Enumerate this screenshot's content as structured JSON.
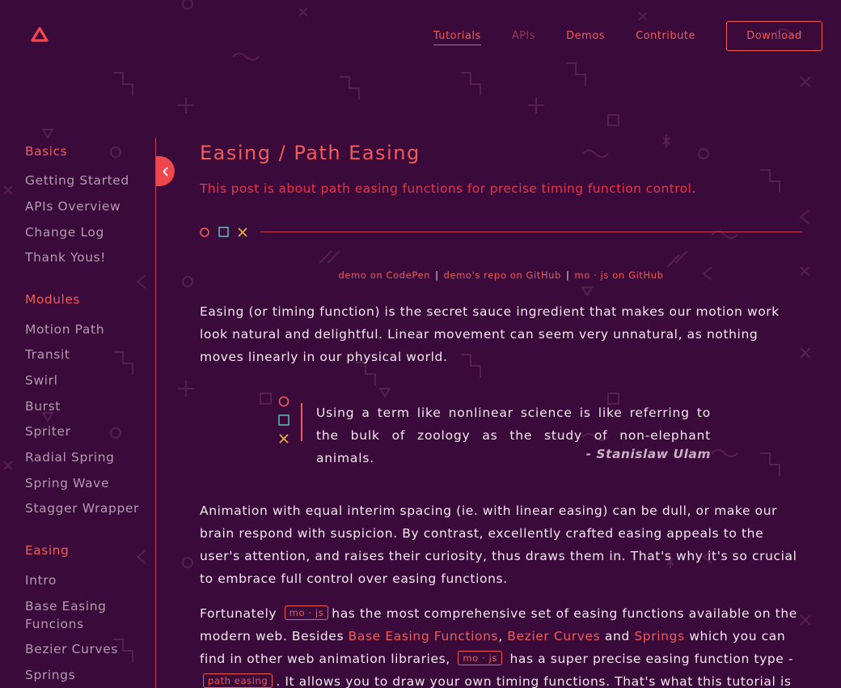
{
  "header": {
    "nav": [
      {
        "label": "Tutorials"
      },
      {
        "label": "APIs"
      },
      {
        "label": "Demos"
      },
      {
        "label": "Contribute"
      }
    ],
    "download_label": "Download"
  },
  "sidebar": {
    "groups": [
      {
        "title": "Basics",
        "items": [
          "Getting Started",
          "APIs Overview",
          "Change Log",
          "Thank Yous!"
        ]
      },
      {
        "title": "Modules",
        "items": [
          "Motion Path",
          "Transit",
          "Swirl",
          "Burst",
          "Spriter",
          "Radial Spring",
          "Spring Wave",
          "Stagger Wrapper"
        ]
      },
      {
        "title": "Easing",
        "items": [
          "Intro",
          "Base Easing Funcions",
          "Bezier Curves",
          "Springs"
        ]
      }
    ]
  },
  "main": {
    "title": "Easing / Path Easing",
    "subtitle": "This post is about path easing functions for precise timing function control.",
    "links": [
      "demo on CodePen",
      "demo's repo on GitHub",
      "mo · js on GitHub"
    ],
    "links_sep": "|",
    "para1": "Easing (or timing function) is the secret sauce ingredient that makes our motion work look natural and delightful. Linear movement can seem very unnatural, as nothing moves linearly in our physical world.",
    "quote": "Using a term like nonlinear science is like referring to the bulk of zoology as the study of non-elephant animals.",
    "quote_author": "- Stanislaw Ulam",
    "para2": "Animation with equal interim spacing (ie. with linear easing) can be dull, or make our brain respond with suspicion. By contrast, excellently crafted easing appeals to the user's attention, and raises their curiosity, thus draws them in. That's why it's so crucial to embrace full control over easing functions.",
    "para3": {
      "t1": "Fortunately",
      "tag1": "mo · js",
      "t2": "has the most comprehensive set of easing functions available on the modern web. Besides",
      "link1": "Base Easing Functions",
      "t3": ",",
      "link2": "Bezier Curves",
      "t4": "and",
      "link3": "Springs",
      "t5": "which you can find in other web animation libraries,",
      "tag2": "mo · js",
      "t6": "has a super precise easing function type -",
      "tag3": "path easing",
      "t7": ". It allows you to draw your own timing functions. That's what this tutorial is dedicated"
    }
  },
  "colors": {
    "background": "#3a0a3a",
    "accent": "#f05b5b",
    "text": "#f3e6ef",
    "muted": "#b49ab0"
  }
}
